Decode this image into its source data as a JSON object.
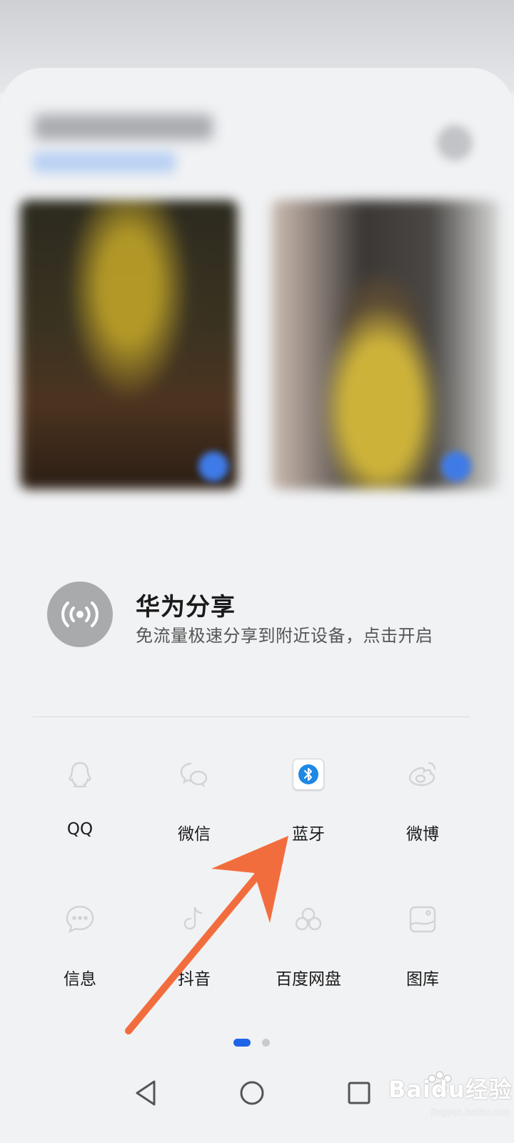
{
  "share": {
    "title": "华为分享",
    "subtitle": "免流量极速分享到附近设备，点击开启"
  },
  "apps": [
    {
      "label": "QQ",
      "icon": "qq-icon"
    },
    {
      "label": "微信",
      "icon": "wechat-icon"
    },
    {
      "label": "蓝牙",
      "icon": "bluetooth-icon"
    },
    {
      "label": "微博",
      "icon": "weibo-icon"
    },
    {
      "label": "信息",
      "icon": "messages-icon"
    },
    {
      "label": "抖音",
      "icon": "douyin-icon"
    },
    {
      "label": "百度网盘",
      "icon": "baidu-netdisk-icon"
    },
    {
      "label": "图库",
      "icon": "gallery-icon"
    }
  ],
  "pager": {
    "pages": 2,
    "current": 1
  },
  "colors": {
    "accent": "#1f64e6",
    "annotation_arrow": "#f26d3d",
    "bluetooth": "#1e88e5"
  },
  "watermark": {
    "text": "Baidu经验",
    "url": "jingyan.baidu.com"
  }
}
